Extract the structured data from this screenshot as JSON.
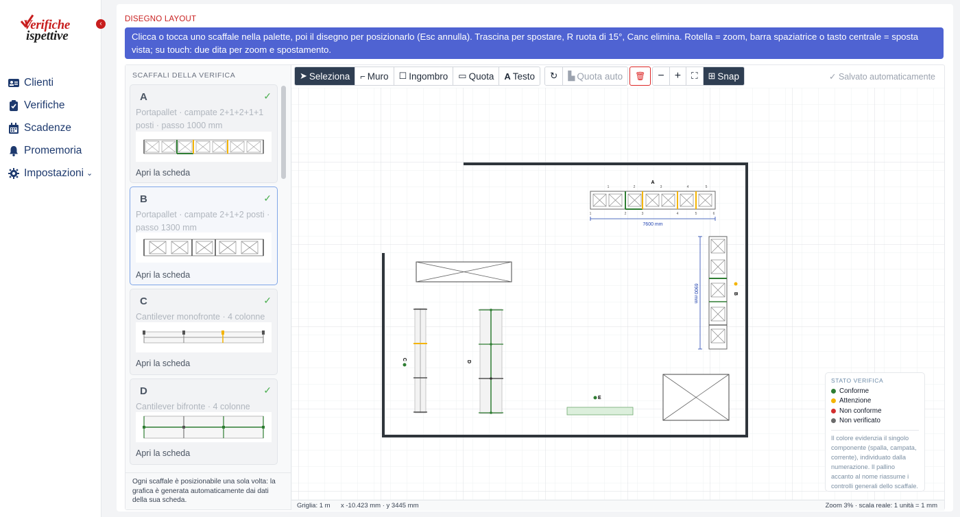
{
  "brand": {
    "line1": "Verifiche",
    "line2": "ispettive"
  },
  "sidebar": {
    "collapse_icon": "‹",
    "items": [
      {
        "label": "Clienti",
        "icon": "id-card-icon"
      },
      {
        "label": "Verifiche",
        "icon": "clipboard-check-icon"
      },
      {
        "label": "Scadenze",
        "icon": "calendar-icon"
      },
      {
        "label": "Promemoria",
        "icon": "bell-icon"
      },
      {
        "label": "Impostazioni",
        "icon": "gear-icon",
        "chevron": "⌄"
      }
    ]
  },
  "page": {
    "section_title": "DISEGNO LAYOUT",
    "banner": "Clicca o tocca uno scaffale nella palette, poi il disegno per posizionarlo (Esc annulla). Trascina per spostare, R ruota di 15°, Canc elimina. Rotella = zoom, barra spaziatrice o tasto centrale = sposta vista; su touch: due dita per zoom e spostamento."
  },
  "palette": {
    "title": "SCAFFALI DELLA VERIFICA",
    "cards": [
      {
        "letter": "A",
        "description": "Portapallet · campate 2+1+2+1+1 posti · passo 1000 mm",
        "link": "Apri la scheda",
        "check": "✓"
      },
      {
        "letter": "B",
        "description": "Portapallet · campate 2+1+2 posti · passo 1300 mm",
        "link": "Apri la scheda",
        "check": "✓"
      },
      {
        "letter": "C",
        "description": "Cantilever monofronte · 4 colonne",
        "link": "Apri la scheda",
        "check": "✓"
      },
      {
        "letter": "D",
        "description": "Cantilever bifronte · 4 colonne",
        "link": "Apri la scheda",
        "check": "✓"
      }
    ],
    "footer": "Ogni scaffale è posizionabile una sola volta: la grafica è generata automaticamente dai dati della sua scheda."
  },
  "toolbar": {
    "select": "Seleziona",
    "wall": "Muro",
    "footprint": "Ingombro",
    "dimension": "Quota",
    "text": "Testo",
    "redo_icon": "↻",
    "auto_dimension": "Quota auto",
    "delete_icon": "🗑",
    "zoom_out": "−",
    "zoom_in": "+",
    "fit_icon": "⛶",
    "snap": "Snap",
    "saved": "✓ Salvato automaticamente"
  },
  "drawing": {
    "labels": {
      "A": "A",
      "B": "B",
      "C": "C",
      "D": "D",
      "E": "E"
    },
    "dim_a": "7600 mm",
    "dim_b": "6900 mm",
    "a_top_numbers": [
      "1",
      "2",
      "3",
      "4",
      "5"
    ],
    "a_bottom_numbers": [
      "1",
      "2",
      "3",
      "4",
      "5",
      "6"
    ]
  },
  "legend": {
    "title": "STATO VERIFICA",
    "items": [
      {
        "label": "Conforme",
        "color": "#2e7d32"
      },
      {
        "label": "Attenzione",
        "color": "#f4b400"
      },
      {
        "label": "Non conforme",
        "color": "#d32f2f"
      },
      {
        "label": "Non verificato",
        "color": "#6b6b6b"
      }
    ],
    "note": "Il colore evidenzia il singolo componente (spalla, campata, corrente), individuato dalla numerazione. Il pallino accanto al nome riassume i controlli generali dello scaffale."
  },
  "statusbar": {
    "grid": "Griglia: 1 m",
    "coords": "x -10.423 mm · y 3445 mm",
    "zoom": "Zoom 3% · scala reale: 1 unità = 1 mm"
  }
}
